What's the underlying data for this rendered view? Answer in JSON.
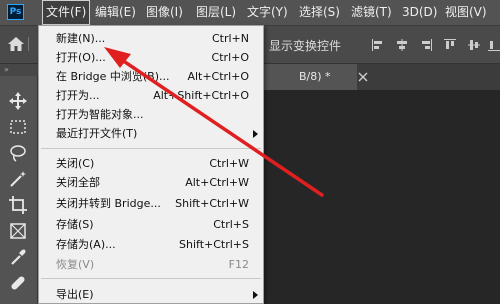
{
  "app": {
    "logo_text": "Ps"
  },
  "menubar": {
    "items": [
      {
        "label": "文件(F)",
        "active": true
      },
      {
        "label": "编辑(E)"
      },
      {
        "label": "图像(I)"
      },
      {
        "label": "图层(L)"
      },
      {
        "label": "文字(Y)"
      },
      {
        "label": "选择(S)"
      },
      {
        "label": "滤镜(T)"
      },
      {
        "label": "3D(D)"
      },
      {
        "label": "视图(V)"
      }
    ]
  },
  "options_bar": {
    "show_transform_label": "显示变换控件"
  },
  "document_tab": {
    "title": "B/8) *"
  },
  "file_menu": {
    "items": [
      {
        "label": "新建(N)...",
        "shortcut": "Ctrl+N"
      },
      {
        "label": "打开(O)...",
        "shortcut": "Ctrl+O"
      },
      {
        "label": "在 Bridge 中浏览(B)...",
        "shortcut": "Alt+Ctrl+O"
      },
      {
        "label": "打开为...",
        "shortcut": "Alt+Shift+Ctrl+O"
      },
      {
        "label": "打开为智能对象...",
        "shortcut": ""
      },
      {
        "label": "最近打开文件(T)",
        "shortcut": "",
        "submenu": true
      },
      {
        "label": "关闭(C)",
        "shortcut": "Ctrl+W"
      },
      {
        "label": "关闭全部",
        "shortcut": "Alt+Ctrl+W"
      },
      {
        "label": "关闭并转到 Bridge...",
        "shortcut": "Shift+Ctrl+W"
      },
      {
        "label": "存储(S)",
        "shortcut": "Ctrl+S"
      },
      {
        "label": "存储为(A)...",
        "shortcut": "Shift+Ctrl+S"
      },
      {
        "label": "恢复(V)",
        "shortcut": "F12",
        "disabled": true
      },
      {
        "label": "导出(E)",
        "shortcut": "",
        "submenu": true
      }
    ]
  },
  "annotation": {
    "arrow_color": "#e02020"
  },
  "colors": {
    "menubar_bg": "#535353",
    "menu_bg": "#f0f0f0",
    "canvas_bg": "#262626"
  }
}
